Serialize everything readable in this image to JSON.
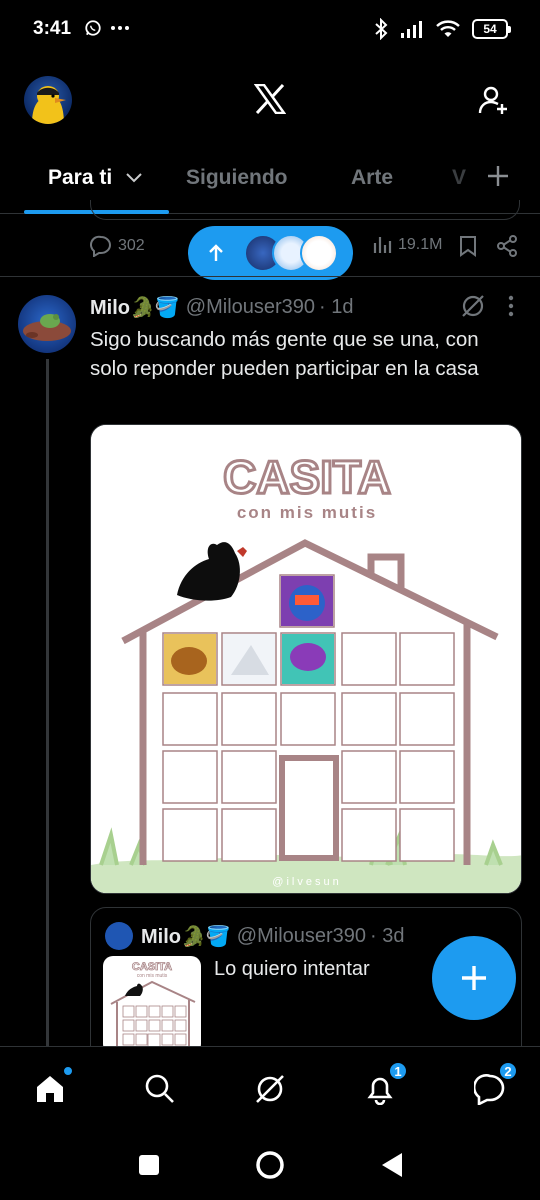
{
  "status_bar": {
    "time": "3:41",
    "battery": "54",
    "icons": [
      "whatsapp-icon",
      "more-icon",
      "bluetooth-icon",
      "signal-icon",
      "wifi-icon",
      "battery-icon"
    ]
  },
  "header": {
    "logo": "X",
    "icons": [
      "avatar",
      "x-logo-icon",
      "follow-user-icon"
    ]
  },
  "tabs": [
    {
      "label": "Para ti",
      "active": true
    },
    {
      "label": "Siguiendo"
    },
    {
      "label": "Arte"
    },
    {
      "label": "V"
    }
  ],
  "previous_post": {
    "replies": "302",
    "views": "19.1M"
  },
  "tweet": {
    "name": "Milo🐊🪣",
    "handle": "@Milouser390",
    "time": "· 1d",
    "text": "Sigo buscando más gente que se una, con solo reponder pueden participar en la casa",
    "image": {
      "title": "CASITA",
      "subtitle": "con mis mutis",
      "watermark": "@ilvesun"
    }
  },
  "quote": {
    "name": "Milo🐊🪣",
    "handle": "@Milouser390",
    "time": "· 3d",
    "text": "Lo quiero intentar",
    "thumb_title": "CASITA",
    "thumb_subtitle": "con mis mutis"
  },
  "bottom_nav": {
    "notifications_badge": "1",
    "messages_badge": "2"
  },
  "colors": {
    "accent": "#1d9bf0",
    "background": "#000000",
    "text_secondary": "#71767b",
    "house": "#a88486",
    "grass": "#bfe0b0"
  }
}
